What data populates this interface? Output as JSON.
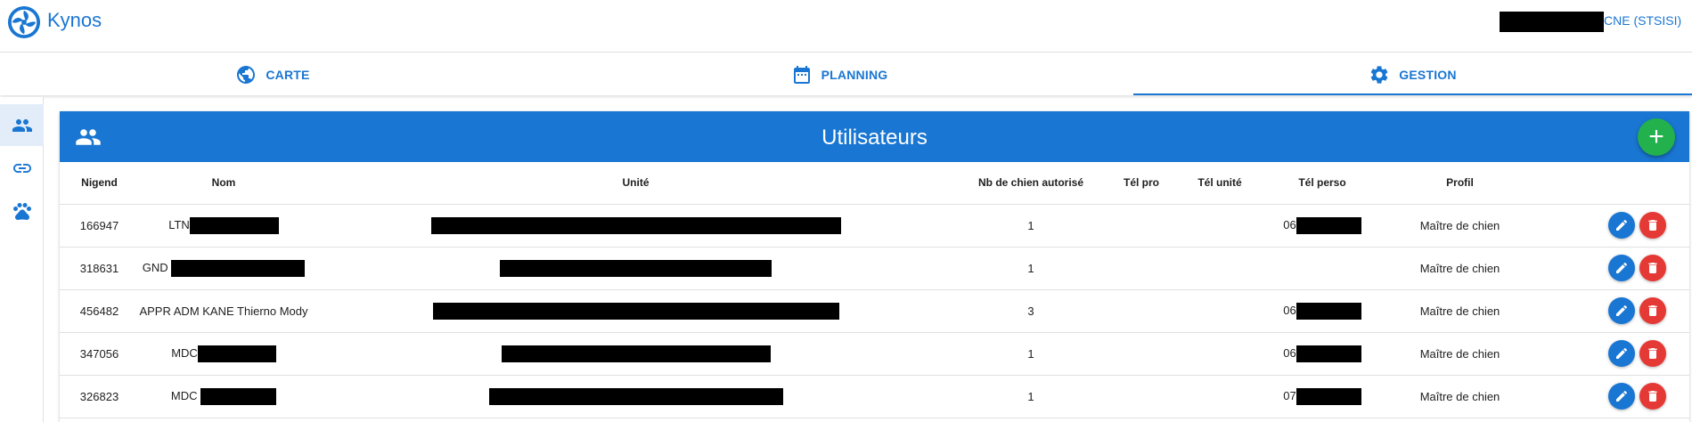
{
  "app": {
    "title": "Kynos",
    "user_label": "CNE (STSISI)"
  },
  "colors": {
    "primary": "#1976d2",
    "add": "#22b14c",
    "delete": "#e53935"
  },
  "tabs": [
    {
      "label": "CARTE",
      "icon": "globe-icon"
    },
    {
      "label": "PLANNING",
      "icon": "calendar-icon"
    },
    {
      "label": "GESTION",
      "icon": "gear-icon",
      "active": true
    }
  ],
  "rail": [
    {
      "icon": "users-icon",
      "active": true
    },
    {
      "icon": "link-icon"
    },
    {
      "icon": "paw-icon"
    }
  ],
  "panel": {
    "title": "Utilisateurs",
    "add_label": "+"
  },
  "table": {
    "headers": [
      "Nigend",
      "Nom",
      "Unité",
      "Nb de chien autorisé",
      "Tél pro",
      "Tél unité",
      "Tél perso",
      "Profil",
      ""
    ],
    "rows": [
      {
        "nigend": "166947",
        "nom": "LTN",
        "nb": "1",
        "tel_perso": "06",
        "profil": "Maître de chien"
      },
      {
        "nigend": "318631",
        "nom": "GND",
        "nb": "1",
        "tel_perso": "",
        "profil": "Maître de chien"
      },
      {
        "nigend": "456482",
        "nom": "APPR ADM KANE Thierno Mody",
        "nb": "3",
        "tel_perso": "06",
        "profil": "Maître de chien"
      },
      {
        "nigend": "347056",
        "nom": "MDC",
        "nb": "1",
        "tel_perso": "06",
        "profil": "Maître de chien"
      },
      {
        "nigend": "326823",
        "nom": "MDC",
        "nb": "1",
        "tel_perso": "07",
        "profil": "Maître de chien"
      }
    ]
  }
}
